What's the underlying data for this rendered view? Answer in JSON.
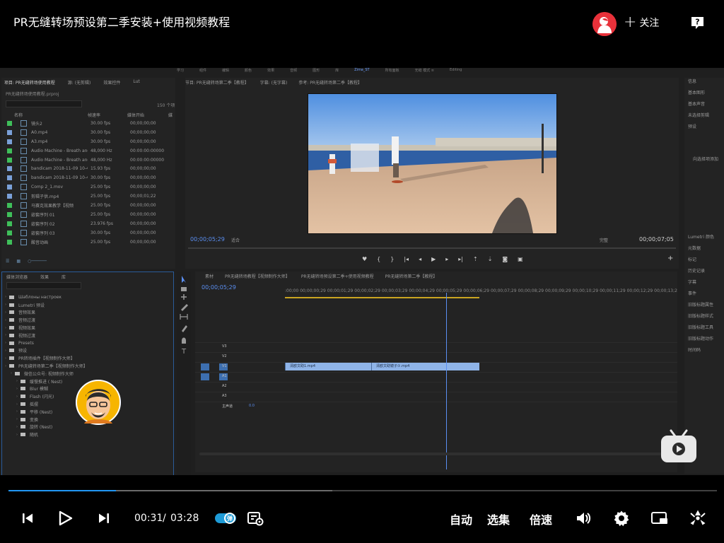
{
  "video": {
    "title": "PR无缝转场预设第二季安装+使用视频教程",
    "follow_label": "关注",
    "help_label": "?"
  },
  "premiere": {
    "menu": [
      "学习",
      "组件",
      "编辑",
      "颜色",
      "效果",
      "音频",
      "图形",
      "库",
      "Zima_ST",
      "所有面板",
      "无缝 模式 ≡",
      "Editing"
    ],
    "project_tabs": [
      "项目: PR无缝转场使用教程",
      "源: (无剪辑)",
      "效果控件",
      "Lut"
    ],
    "project_file": "PR无缝转场使用教程.prproj",
    "project_count": "150 个项",
    "project_columns": [
      "名称",
      "帧速率",
      "媒体开始",
      "媒"
    ],
    "project_items": [
      {
        "name": "镜头2",
        "rate": "30.00 fps",
        "start": "00;00;00;00",
        "color": "#3fbf5a"
      },
      {
        "name": "A0.mp4",
        "rate": "30.00 fps",
        "start": "00;00;00;00",
        "color": "#7aa0d8"
      },
      {
        "name": "A3.mp4",
        "rate": "30.00 fps",
        "start": "00;00;00;00",
        "color": "#7aa0d8"
      },
      {
        "name": "Audio Machine - Breath and",
        "rate": "48,000 Hz",
        "start": "00:00:00:00000",
        "color": "#3fbf5a"
      },
      {
        "name": "Audio Machine - Breath and",
        "rate": "48,000 Hz",
        "start": "00:00:00:00000",
        "color": "#3fbf5a"
      },
      {
        "name": "bandicam 2018-11-09 10-42-",
        "rate": "15.93 fps",
        "start": "00;00;00;00",
        "color": "#7aa0d8"
      },
      {
        "name": "bandicam 2018-11-09 10-47-",
        "rate": "30.00 fps",
        "start": "00;00;00;00",
        "color": "#7aa0d8"
      },
      {
        "name": "Comp 2_1.mov",
        "rate": "25.00 fps",
        "start": "00;00;00;00",
        "color": "#7aa0d8"
      },
      {
        "name": "剪辑子供.mp4",
        "rate": "25.00 fps",
        "start": "00;00;01;22",
        "color": "#7aa0d8"
      },
      {
        "name": "马赛克效果教学【视频",
        "rate": "25.00 fps",
        "start": "00;00;00;00",
        "color": "#3fbf5a"
      },
      {
        "name": "嵌套序列 01",
        "rate": "25.00 fps",
        "start": "00;00;00;00",
        "color": "#3fbf5a"
      },
      {
        "name": "嵌套序列 02",
        "rate": "23.976 fps",
        "start": "00;00;00;00",
        "color": "#3fbf5a"
      },
      {
        "name": "嵌套序列 03",
        "rate": "30.00 fps",
        "start": "00;00;00;00",
        "color": "#3fbf5a"
      },
      {
        "name": "酸音动画",
        "rate": "25.00 fps",
        "start": "00;00;00;00",
        "color": "#3fbf5a"
      }
    ],
    "monitor_tabs": [
      "节目: PR无缝转场第二季【教程】",
      "字幕: (无字幕)",
      "参考: PR无缝转场第二季【教程】"
    ],
    "monitor_tc_left": "00;00;05;29",
    "monitor_fit": "适合",
    "monitor_quality": "完整",
    "monitor_tc_right": "00;00;07;05",
    "effects_tabs": [
      "媒体浏览器",
      "效果",
      "库"
    ],
    "effects_items": [
      {
        "label": "Шаблоны настроек",
        "level": 0
      },
      {
        "label": "Lumetri 预设",
        "level": 0
      },
      {
        "label": "音频效果",
        "level": 0
      },
      {
        "label": "音频过渡",
        "level": 0
      },
      {
        "label": "视频效果",
        "level": 0
      },
      {
        "label": "视频过渡",
        "level": 0
      },
      {
        "label": "Presets",
        "level": 0
      },
      {
        "label": "预设",
        "level": 0
      },
      {
        "label": "PR转场插件【视频制作大师】",
        "level": 0
      },
      {
        "label": "PR无缝转场第二季【视频制作大师】",
        "level": 0
      },
      {
        "label": "微信公众号: 视频制作大师",
        "level": 1
      },
      {
        "label": "缓慢推进 ( Nest)",
        "level": 2
      },
      {
        "label": "Blur 模糊",
        "level": 2
      },
      {
        "label": "Flash (闪光)",
        "level": 2
      },
      {
        "label": "摇摆",
        "level": 2
      },
      {
        "label": "平移 (Nest)",
        "level": 2
      },
      {
        "label": "变换",
        "level": 2
      },
      {
        "label": "旋转 (Nest)",
        "level": 2
      },
      {
        "label": "随机",
        "level": 2
      }
    ],
    "timeline_tabs": [
      "素材",
      "PR无缝转场教程【视频制作大师】",
      "PR无缝转场预设第二季+使用视频教程",
      "PR无缝转场第二季【教程】"
    ],
    "timeline_tc": "00;00;05;29",
    "timeline_ticks": [
      ":00;00",
      "00;00;00;29",
      "00;00;01;29",
      "00;00;02;29",
      "00;00;03;29",
      "00;00;04;29",
      "00;00;05;29",
      "00;00;06;29",
      "00;00;07;29",
      "00;00;08;29",
      "00;00;09;29",
      "00;00;10;29",
      "00;00;11;29",
      "00;00;12;29",
      "00;00;13;2"
    ],
    "tracks": [
      {
        "label": "V3"
      },
      {
        "label": "V2"
      },
      {
        "label": "V1"
      },
      {
        "label": "A1"
      },
      {
        "label": "A2"
      },
      {
        "label": "A3"
      },
      {
        "label": "主声道"
      }
    ],
    "master_vol": "0.0",
    "clips": [
      "清欧文助1.mp4",
      "清欧文助镜子①.mp4"
    ],
    "right_panel_top": [
      "信息",
      "基本图形",
      "基本声音",
      "未选择剪辑",
      "预设"
    ],
    "right_panel_mid": [
      "向选择项添加"
    ],
    "right_panel_bottom": [
      "Lumetri 颜色",
      "元数据",
      "标记",
      "历史记录",
      "字幕",
      "事件",
      "旧版标题属性",
      "旧版标题样式",
      "旧版标题工具",
      "旧版标题动作",
      "时间码"
    ]
  },
  "player": {
    "current_time": "00:31",
    "separator": "/",
    "total_time": "03:28",
    "auto_label": "自动",
    "episodes_label": "选集",
    "speed_label": "倍速",
    "progress_played": 0.152,
    "progress_buffered": 0.457,
    "colors": {
      "accent": "#2196f3",
      "toggle": "#1e9bd7"
    },
    "icons": [
      "prev-icon",
      "play-icon",
      "next-icon",
      "danmaku-toggle-icon",
      "danmaku-settings-icon",
      "volume-icon",
      "settings-icon",
      "pip-icon",
      "fullscreen-icon"
    ]
  }
}
